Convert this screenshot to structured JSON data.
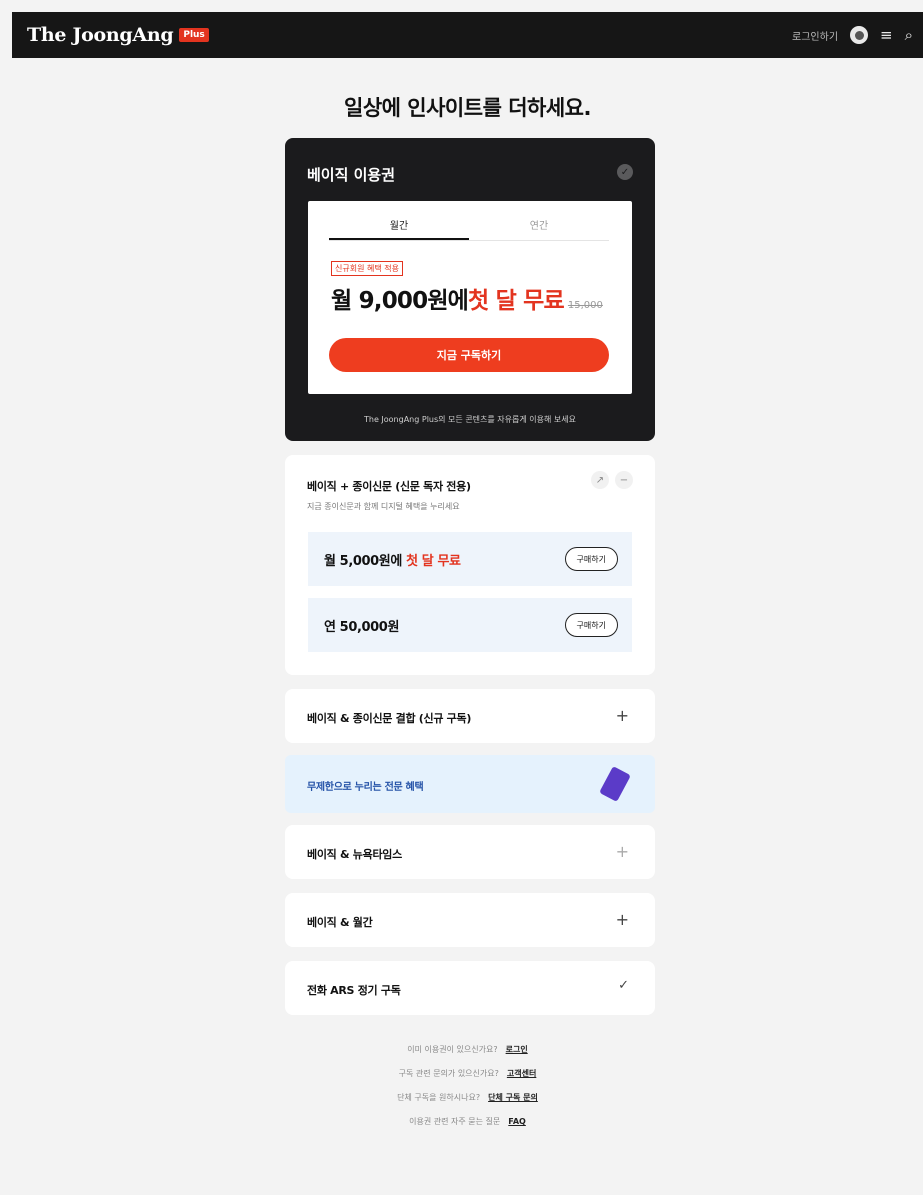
{
  "topbar": {
    "logo_text": "The JoongAng",
    "logo_badge": "Plus",
    "login_label": "로그인하기"
  },
  "headline": "일상에 인사이트를 더하세요.",
  "premium": {
    "title": "베이직 이용권",
    "tabs": [
      "월간",
      "연간"
    ],
    "promo_tag": "신규회원 혜택 적용",
    "price_prefix": "월 9,000원에",
    "price_highlight": "첫 달 무료",
    "price_old": "15,000",
    "subscribe_label": "지금 구독하기",
    "note": "The JoongAng Plus의 모든 콘텐츠를 자유롭게 이용해 보세요"
  },
  "newspaper_bundle": {
    "title": "베이직 + 종이신문 (신문 독자 전용)",
    "desc": "지금 종이신문과 함께 디지털 혜택을 누리세요",
    "options": [
      {
        "price_prefix": "월 5,000원에",
        "price_highlight": "첫 달 무료",
        "button": "구매하기"
      },
      {
        "price_prefix": "연 50,000원",
        "price_highlight": "",
        "button": "구매하기"
      }
    ]
  },
  "accordions": [
    {
      "title": "베이직 & 종이신문 결합 (신규 구독)",
      "toggle": "+"
    },
    {
      "title": "베이직 & 뉴욕타임스",
      "toggle": "+"
    },
    {
      "title": "베이직 & 월간",
      "toggle": "+"
    },
    {
      "title": "전화 ARS 정기 구독",
      "toggle": "✓"
    }
  ],
  "benefit_banner": "무제한으로 누리는 전문 혜택",
  "footer": [
    {
      "text": "이미 이용권이 있으신가요?",
      "link": "로그인"
    },
    {
      "text": "구독 관련 문의가 있으신가요?",
      "link": "고객센터"
    },
    {
      "text": "단체 구독을 원하시나요?",
      "link": "단체 구독 문의"
    },
    {
      "text": "이용권 관련 자주 묻는 질문",
      "link": "FAQ"
    }
  ],
  "colors": {
    "accent": "#ee3d1f",
    "dark": "#1b1b1d",
    "benefit_text": "#2553a8"
  }
}
